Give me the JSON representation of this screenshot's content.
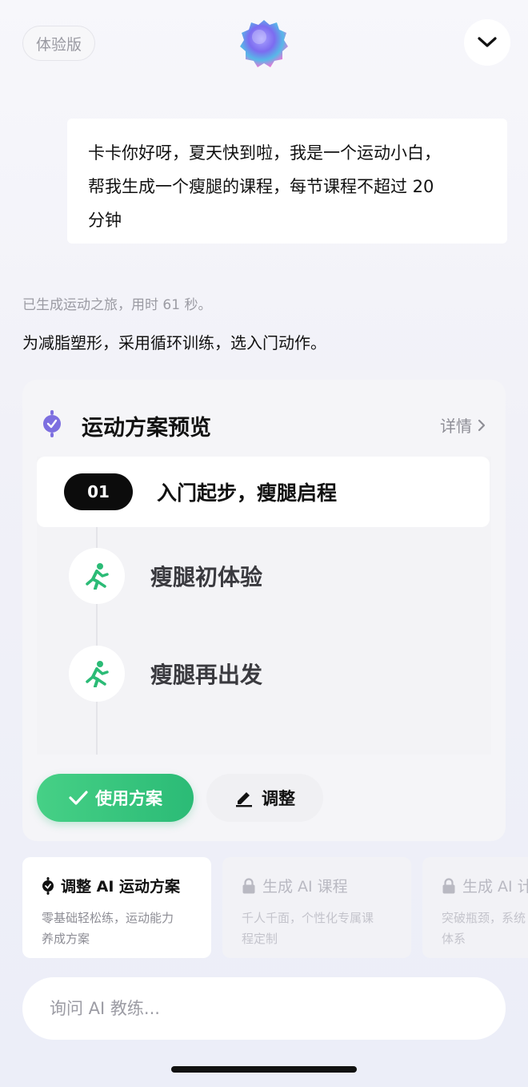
{
  "header": {
    "trial_badge": "体验版"
  },
  "chat": {
    "user_message_lines": [
      "卡卡你好呀，夏天快到啦，我是一个运动小白，",
      "帮我生成一个瘦腿的课程，每节课程不超过 20",
      "分钟"
    ],
    "status": "已生成运动之旅，用时 61 秒。",
    "summary": "为减脂塑形，采用循环训练，选入门动作。"
  },
  "plan": {
    "title": "运动方案预览",
    "detail_label": "详情",
    "stage": {
      "number": "01",
      "title": "入门起步，瘦腿启程"
    },
    "sessions": [
      {
        "title": "瘦腿初体验",
        "icon": "running-person-icon"
      },
      {
        "title": "瘦腿再出发",
        "icon": "running-person-icon"
      }
    ],
    "use_label": "使用方案",
    "adjust_label": "调整",
    "accent_color": "#2bbb76"
  },
  "suggestions": [
    {
      "title": "调整 AI 运动方案",
      "desc_lines": [
        "零基础轻松练，运动能力",
        "养成方案"
      ],
      "icon": "plan-badge-icon",
      "locked": false
    },
    {
      "title": "生成 AI 课程",
      "desc_lines": [
        "千人千面，个性化专属课",
        "程定制"
      ],
      "icon": "lock-icon",
      "locked": true
    },
    {
      "title": "生成 AI 计",
      "desc_lines": [
        "突破瓶颈，系统",
        "体系"
      ],
      "icon": "lock-icon",
      "locked": true
    }
  ],
  "input": {
    "placeholder": "询问 AI 教练..."
  }
}
